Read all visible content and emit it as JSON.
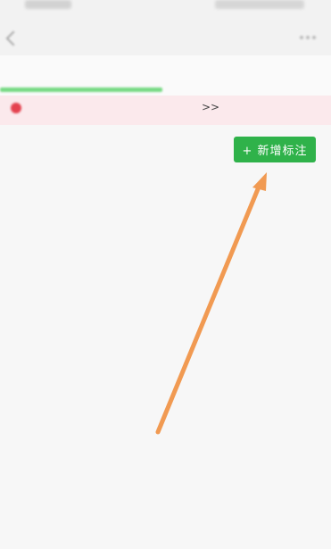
{
  "status_bar": {
    "left": "",
    "right": ""
  },
  "nav": {
    "title": "",
    "back_icon": "chevron-left-icon",
    "more_icon": "more-icon"
  },
  "tabs": [
    {
      "label": "",
      "active": true
    },
    {
      "label": "",
      "active": false
    }
  ],
  "notice": {
    "text": "",
    "link": "",
    "link_arrows": ">>"
  },
  "row": {
    "label": "",
    "add_button": "+ 新增标注"
  },
  "colors": {
    "accent": "#2fb24a",
    "tab_active": "#3dbb52",
    "notice_bg": "#fbe9ec",
    "arrow": "#f19a52"
  }
}
